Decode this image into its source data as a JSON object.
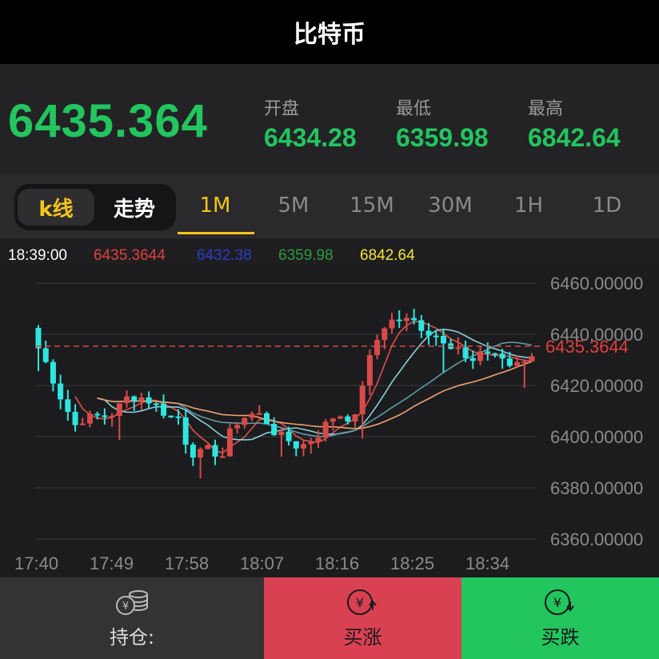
{
  "header": {
    "title": "比特币"
  },
  "quote": {
    "price": "6435.364",
    "open_label": "开盘",
    "open_value": "6434.28",
    "low_label": "最低",
    "low_value": "6359.98",
    "high_label": "最高",
    "high_value": "6842.64"
  },
  "tabs": {
    "kline": "k线",
    "trend": "走势",
    "intervals": [
      "1M",
      "5M",
      "15M",
      "30M",
      "1H",
      "1D"
    ],
    "active": "1M"
  },
  "info_bar": {
    "time": "18:39:00",
    "v1": "6435.3644",
    "v2": "6432.38",
    "v3": "6359.98",
    "v4": "6842.64"
  },
  "chart_data": {
    "type": "candlestick",
    "x_labels": [
      "17:40",
      "17:49",
      "17:58",
      "18:07",
      "18:16",
      "18:25",
      "18:34"
    ],
    "y_labels": [
      "6460.00000",
      "6440.00000",
      "6420.00000",
      "6400.00000",
      "6380.00000",
      "6360.00000"
    ],
    "ylim": [
      6360,
      6460
    ],
    "current_price_label": "6435.3644",
    "current_price": 6435.3644,
    "colors": {
      "up": "#d84a4a",
      "down": "#2ee6e0",
      "ma1": "#e0504a",
      "ma2": "#8ad0d8",
      "ma3": "#5a9ca8",
      "ma4": "#f0a070",
      "grid": "#3a3a3d"
    }
  },
  "bottom": {
    "hold_label": "持仓:",
    "buy_up_label": "买涨",
    "buy_down_label": "买跌",
    "colors": {
      "hold_bg": "#333336",
      "up_bg": "#d94152",
      "down_bg": "#22c55e"
    }
  }
}
